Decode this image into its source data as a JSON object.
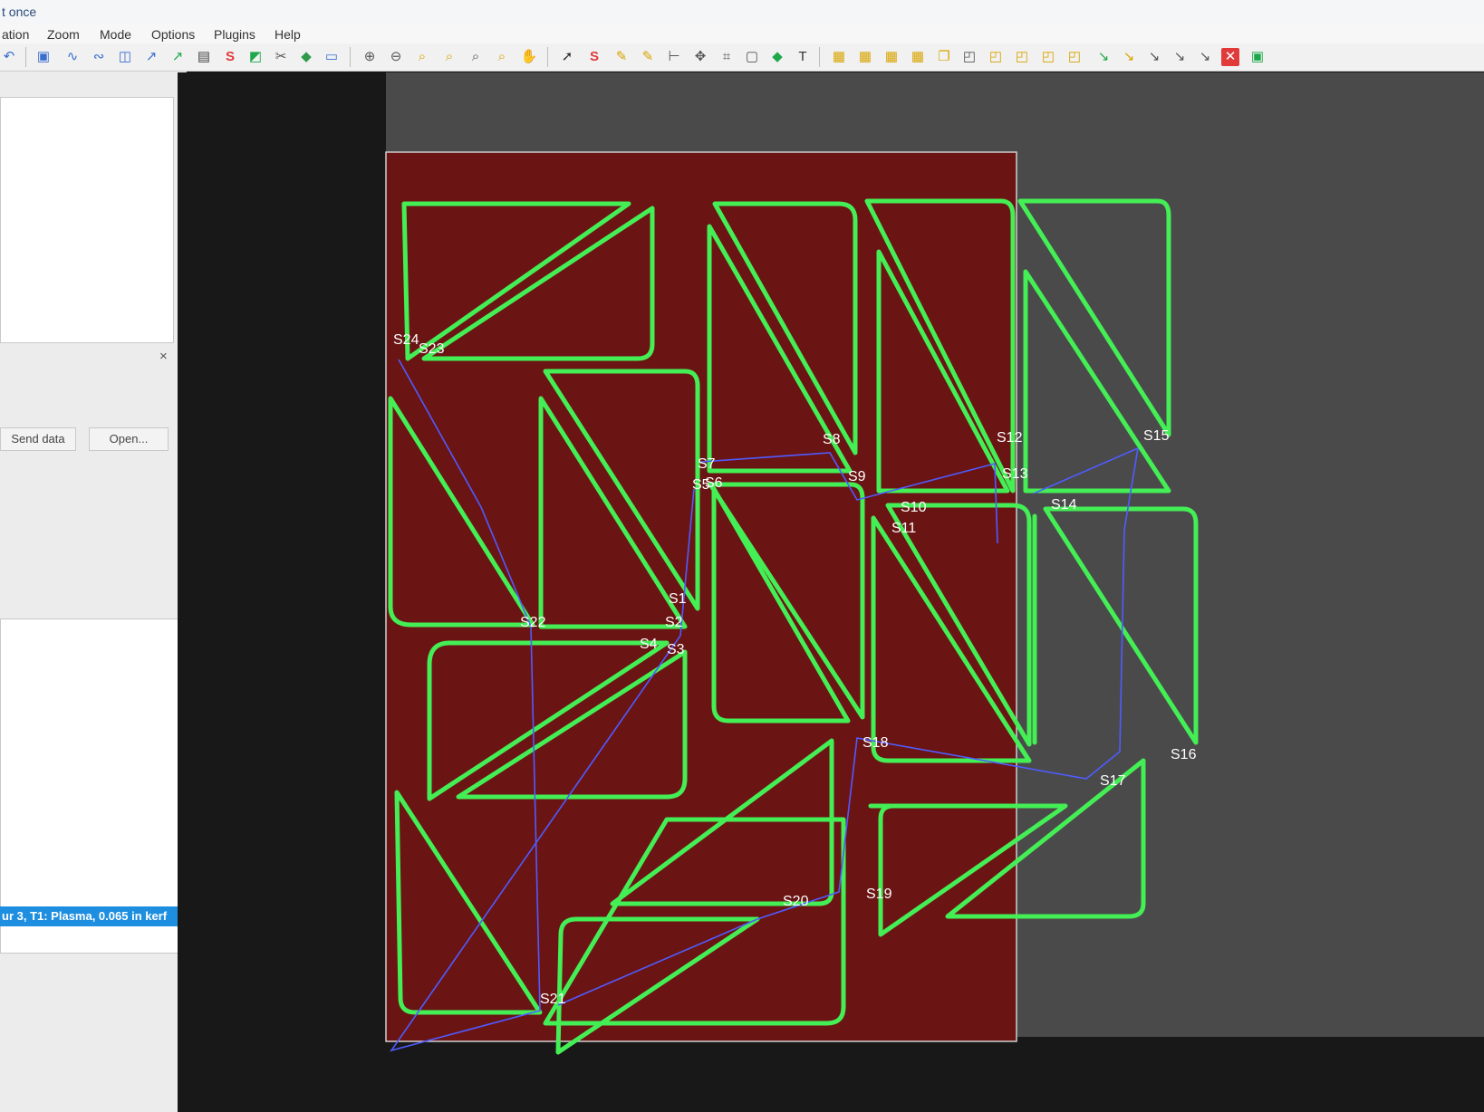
{
  "window": {
    "title": "t once"
  },
  "menu": [
    "ation",
    "Zoom",
    "Mode",
    "Options",
    "Plugins",
    "Help"
  ],
  "toolbar_icons": [
    "undo-icon",
    "select-icon",
    "curve-icon",
    "curve-icon",
    "square-icon",
    "arrow-icon",
    "arrow-icon",
    "layers-icon",
    "snap-icon",
    "import-icon",
    "scissors-icon",
    "cube-icon",
    "window-icon",
    "zoom-in-icon",
    "zoom-out-icon",
    "zoom-fit-icon",
    "zoom-tool-icon",
    "zoom-box-icon",
    "zoom-extents-icon",
    "pan-icon",
    "pointer-icon",
    "start-point-icon",
    "path-icon",
    "path-icon",
    "align-icon",
    "center-icon",
    "bounds-icon",
    "frame-icon",
    "marker-icon",
    "text-icon",
    "nest-icon",
    "nest-icon",
    "nest-icon",
    "nest-icon",
    "layer-icon",
    "part-icon",
    "part-icon",
    "part-icon",
    "part-icon",
    "part-icon",
    "lead-icon",
    "lead-icon",
    "lead-icon",
    "lead-icon",
    "lead-icon",
    "delete-icon",
    "close-icon"
  ],
  "left_panel": {
    "send_data_label": "Send data",
    "open_label": "Open...",
    "close_label": "×",
    "selected_item": "ur 3, T1: Plasma, 0.065 in kerf"
  },
  "canvas": {
    "colors": {
      "sheet": "#6b1414",
      "part_outline": "#44ee55",
      "rapid_path": "#4f5cff",
      "label": "#ffffff"
    },
    "labels": [
      "S24",
      "S23",
      "S1",
      "S2",
      "S3",
      "S4",
      "S5",
      "S6",
      "S7",
      "S8",
      "S9",
      "S10",
      "S11",
      "S12",
      "S13",
      "S14",
      "S15",
      "S16",
      "S17",
      "S18",
      "S19",
      "S20",
      "S21",
      "S22"
    ]
  }
}
